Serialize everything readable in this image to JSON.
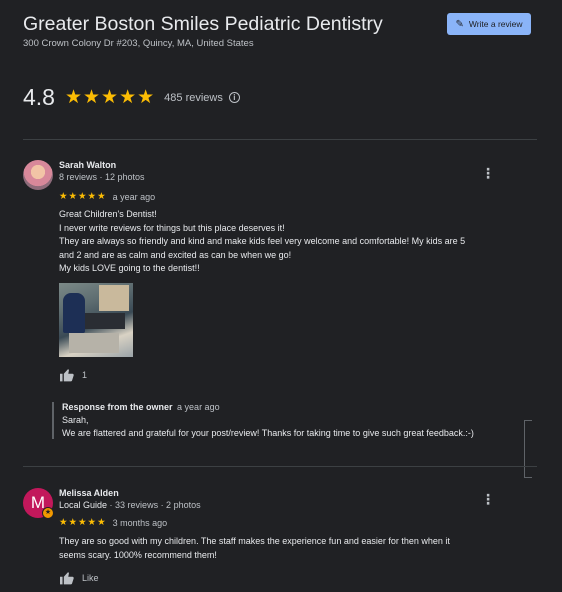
{
  "business": {
    "name": "Greater Boston Smiles Pediatric Dentistry",
    "address": "300 Crown Colony Dr #203, Quincy, MA, United States",
    "rating": "4.8",
    "stars": "★★★★★",
    "review_count": "485 reviews",
    "write_review_label": "Write a review"
  },
  "reviews": [
    {
      "name": "Sarah Walton",
      "meta": "8 reviews · 12 photos",
      "stars": "★★★★★",
      "ago": "a year ago",
      "lines": [
        "Great Children's Dentist!",
        "I never write reviews for things but this place deserves it!",
        "They are always so friendly and kind and make kids feel very welcome and comfortable! My kids are 5",
        "and 2 and are as calm and excited as can be when we go!",
        "My kids LOVE going to the dentist!!"
      ],
      "likes": "1",
      "owner_response": {
        "title": "Response from the owner",
        "ago": "a year ago",
        "lines": [
          "Sarah,",
          "We are flattered and grateful for your post/review! Thanks for taking time to give such great feedback.:-)"
        ]
      }
    },
    {
      "name": "Melissa Alden",
      "avatar_letter": "M",
      "guide_label": "Local Guide",
      "meta": " · 33 reviews · 2 photos",
      "stars": "★★★★★",
      "ago": "3 months ago",
      "lines": [
        "They are so good with my children. The staff makes the experience fun and easier for then when it",
        "seems scary. 1000% recommend them!"
      ],
      "like_label": "Like"
    }
  ],
  "colors": {
    "background": "#202124",
    "star": "#fbbc04",
    "button": "#8ab4f8",
    "avatar_m": "#c2185b"
  }
}
